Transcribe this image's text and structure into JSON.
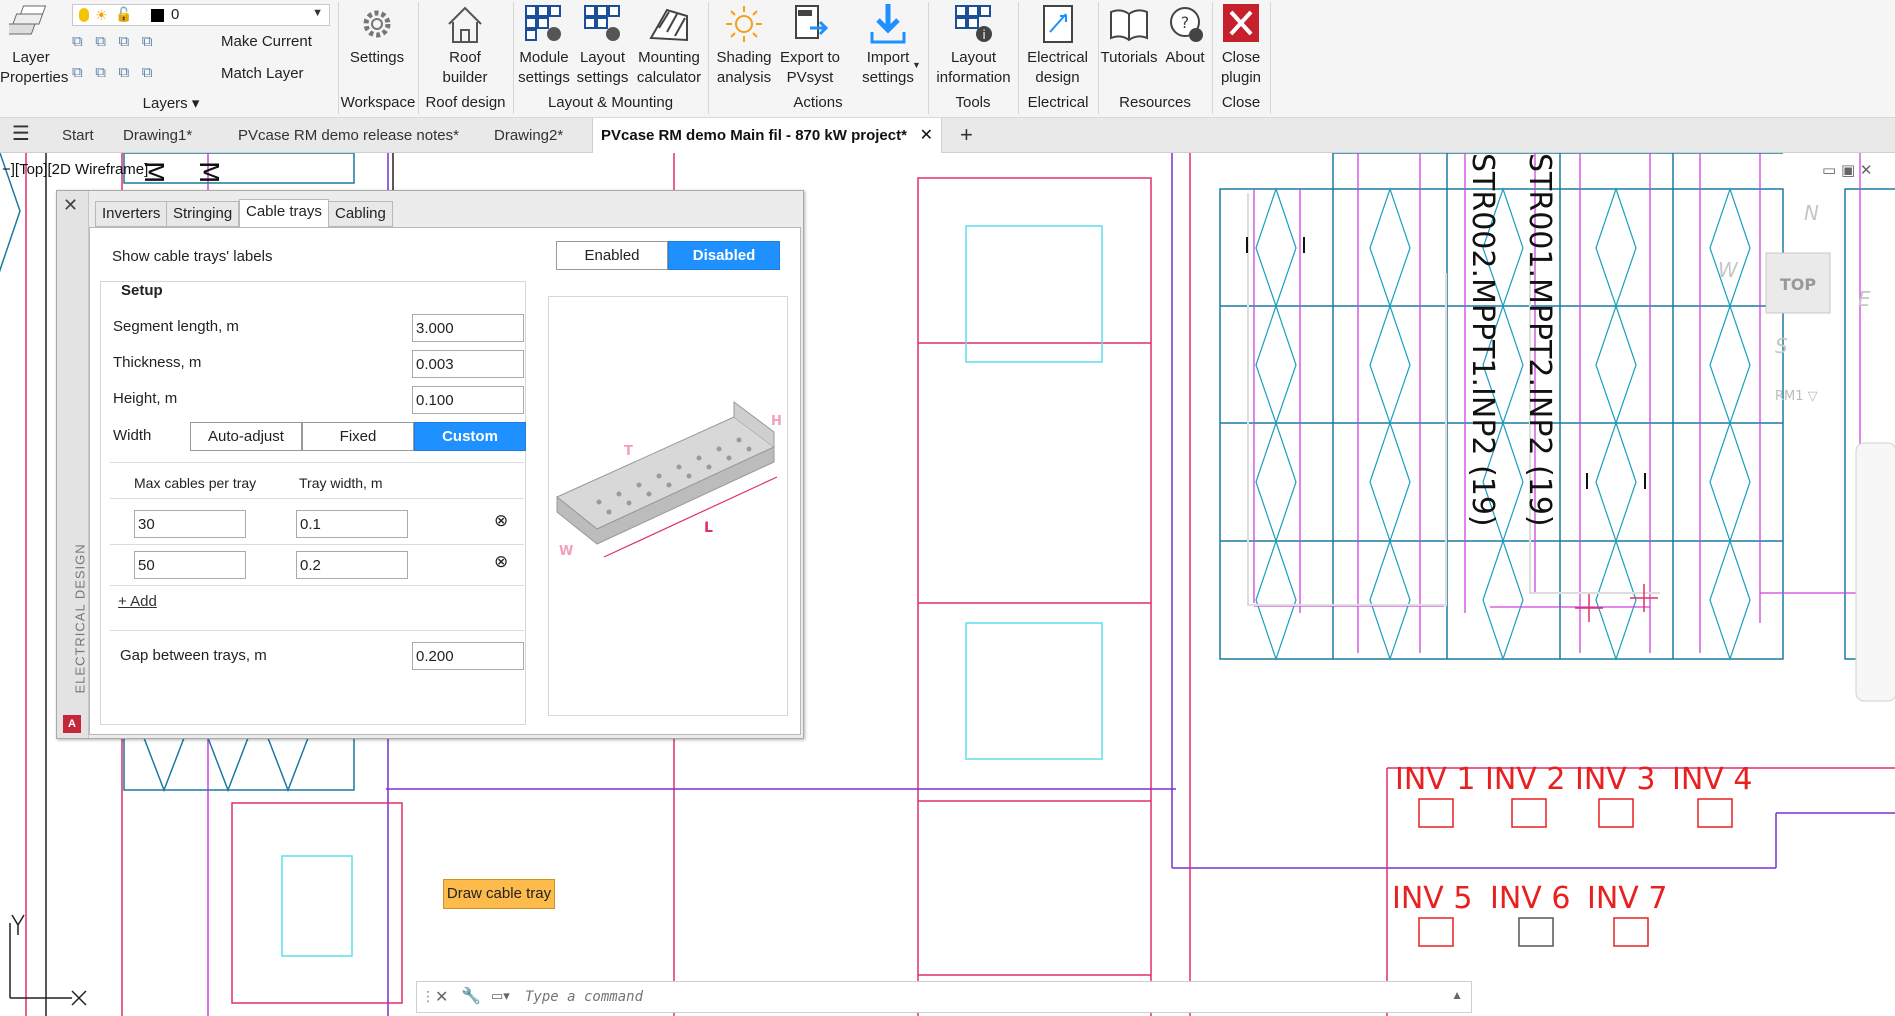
{
  "ribbon": {
    "layer_properties": "Layer\nProperties",
    "layer_name": "0",
    "make_current": "Make Current",
    "match_layer": "Match Layer",
    "layers_group": "Layers ▾",
    "settings": "Settings",
    "roof_builder": "Roof\nbuilder",
    "module_settings": "Module\nsettings",
    "layout_settings": "Layout\nsettings",
    "mounting_calculator": "Mounting\ncalculator",
    "shading_analysis": "Shading\nanalysis",
    "export_pvsyst": "Export to\nPVsyst",
    "import_settings": "Import\nsettings",
    "layout_information": "Layout\ninformation",
    "electrical_design": "Electrical\ndesign",
    "tutorials": "Tutorials",
    "about": "About",
    "close_plugin": "Close\nplugin",
    "groups": {
      "workspace": "Workspace",
      "roof_design": "Roof design",
      "layout_mounting": "Layout & Mounting",
      "actions": "Actions",
      "tools": "Tools",
      "electrical": "Electrical",
      "resources": "Resources",
      "close": "Close"
    }
  },
  "tabs": {
    "start": "Start",
    "drawing1": "Drawing1*",
    "release_notes": "PVcase RM demo release notes*",
    "drawing2": "Drawing2*",
    "active": "PVcase RM demo Main fil - 870 kW project*"
  },
  "viewport": {
    "info": "−][Top][2D Wireframe]",
    "top_label": "TOP",
    "rm1": "RM1 ▽",
    "n": "N",
    "s": "S",
    "w": "W",
    "e": "E"
  },
  "drawing": {
    "string_labels": [
      "STR001.MPPT2.INP2 (19)",
      "STR002.MPPT1.INP2 (19)"
    ],
    "inverters": [
      "INV 1",
      "INV 2",
      "INV 3",
      "INV 4",
      "INV 5",
      "INV 6",
      "INV 7"
    ],
    "left_labels": [
      "M",
      "M"
    ]
  },
  "palette": {
    "side_title": "ELECTRICAL DESIGN",
    "tabs": [
      "Inverters",
      "Stringing",
      "Cable trays",
      "Cabling"
    ],
    "show_labels": "Show cable trays' labels",
    "enabled": "Enabled",
    "disabled": "Disabled",
    "setup": "Setup",
    "segment_length_label": "Segment length, m",
    "segment_length": "3.000",
    "thickness_label": "Thickness, m",
    "thickness": "0.003",
    "height_label": "Height, m",
    "height": "0.100",
    "width_label": "Width",
    "width_options": [
      "Auto-adjust",
      "Fixed",
      "Custom"
    ],
    "col_max_cables": "Max cables per tray",
    "col_tray_width": "Tray width, m",
    "rows": [
      {
        "max": "30",
        "width": "0.1"
      },
      {
        "max": "50",
        "width": "0.2"
      }
    ],
    "add": "+ Add",
    "gap_label": "Gap between trays, m",
    "gap": "0.200",
    "draw_button": "Draw cable tray",
    "tray_dims": {
      "h": "H",
      "t": "T",
      "l": "L",
      "w": "W"
    }
  },
  "command": {
    "placeholder": "Type a command"
  }
}
